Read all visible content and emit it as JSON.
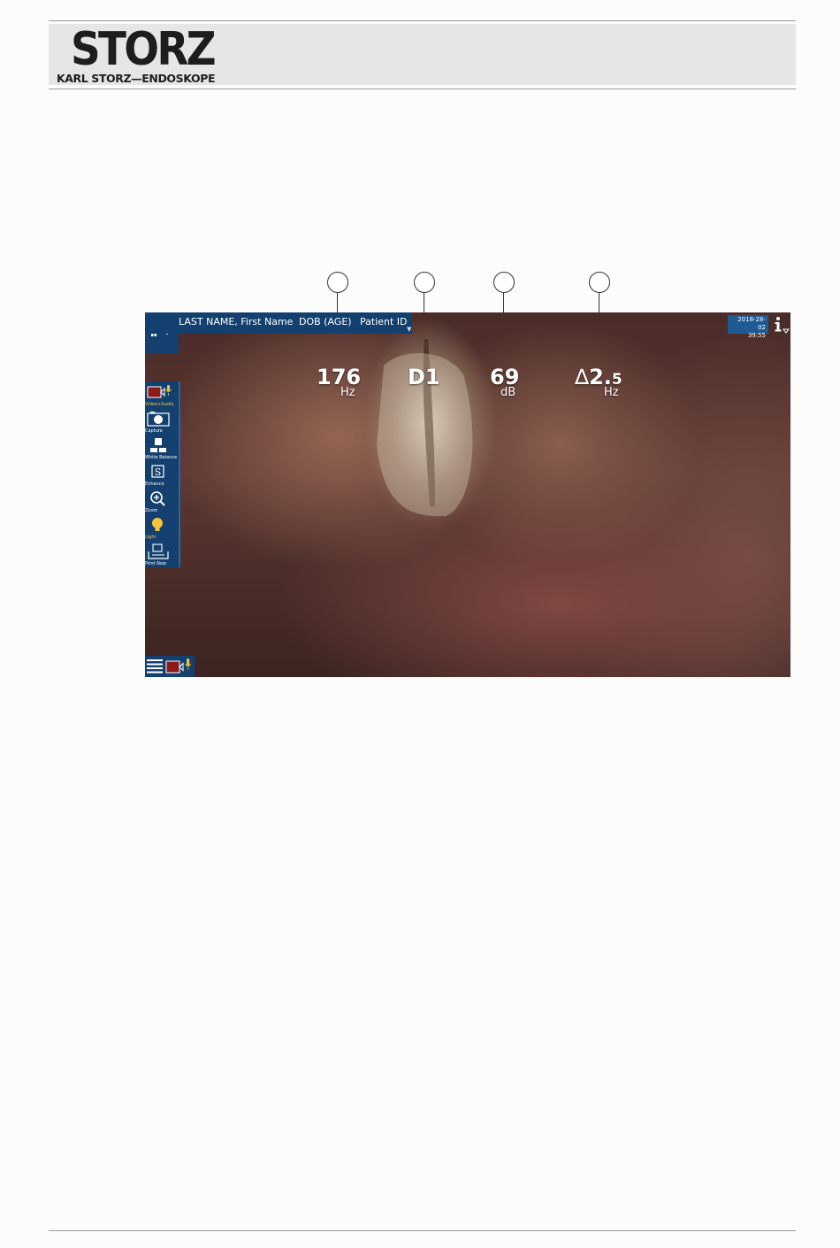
{
  "brand": {
    "logo_text": "STORZ",
    "subtitle": "KARL STORZ—ENDOSKOPE"
  },
  "callouts": [
    {
      "number": ""
    },
    {
      "number": ""
    },
    {
      "number": ""
    },
    {
      "number": ""
    }
  ],
  "patient": {
    "name": "LAST NAME, First Name",
    "dob": "DOB (AGE)",
    "id": "Patient ID",
    "dropdown_icon": "triangle-down-icon"
  },
  "datetime": {
    "date": "2018-28-02",
    "time": "39:55"
  },
  "toolbar": {
    "items": [
      {
        "label": "Video+Audio",
        "icon": "video-audio-icon",
        "active": true
      },
      {
        "label": "Capture",
        "icon": "camera-icon",
        "active": false
      },
      {
        "label": "White Balance",
        "icon": "white-balance-icon",
        "active": false
      },
      {
        "label": "Enhance",
        "icon": "enhance-icon",
        "active": false
      },
      {
        "label": "Zoom",
        "icon": "zoom-icon",
        "active": false
      },
      {
        "label": "Light",
        "icon": "lightbulb-icon",
        "active": true
      },
      {
        "label": "Print Now",
        "icon": "print-icon",
        "active": false
      }
    ]
  },
  "readouts": {
    "frequency": {
      "value": "176",
      "unit": "Hz"
    },
    "mode": {
      "value": "D1"
    },
    "level": {
      "value": "69",
      "unit": "dB"
    },
    "delta": {
      "symbol": "∆",
      "value": "2.",
      "sub": "5",
      "unit": "Hz"
    }
  },
  "colors": {
    "bar_blue": "#14406f",
    "active_yellow": "#f6c33a",
    "record_red": "#8e1b1b"
  }
}
